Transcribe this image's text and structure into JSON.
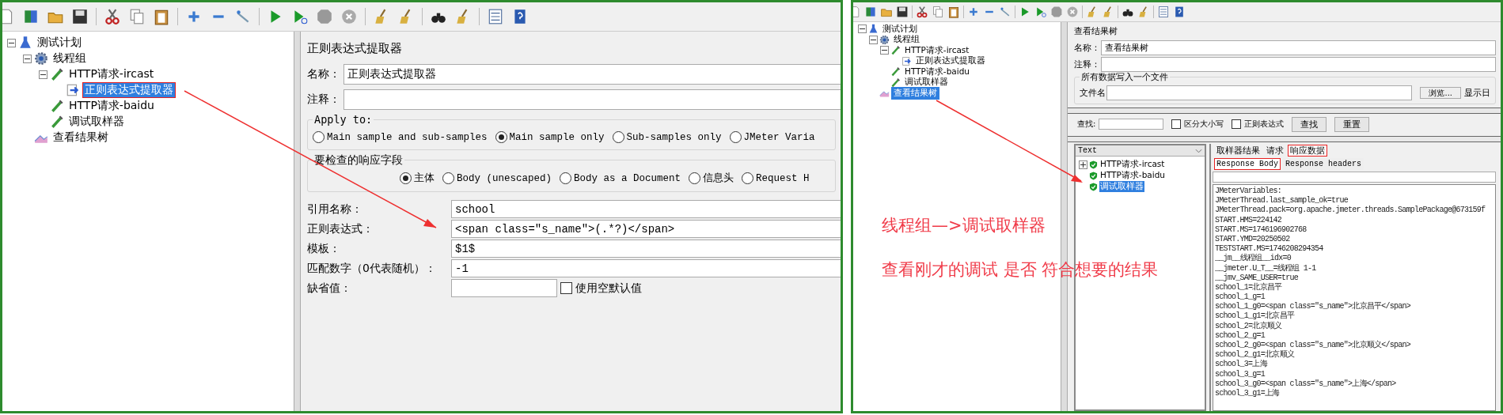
{
  "left_window": {
    "tree": [
      {
        "label": "测试计划",
        "kind": "plan",
        "selected": false,
        "expanded": true,
        "children": [
          {
            "label": "线程组",
            "kind": "threads",
            "selected": false,
            "expanded": true,
            "children": [
              {
                "label": "HTTP请求-ircast",
                "kind": "sampler",
                "selected": false,
                "expanded": true,
                "children": [
                  {
                    "label": "正则表达式提取器",
                    "kind": "extractor",
                    "selected": true,
                    "highlighted": true
                  }
                ]
              },
              {
                "label": "HTTP请求-baidu",
                "kind": "sampler",
                "selected": false
              },
              {
                "label": "调试取样器",
                "kind": "sampler",
                "selected": false
              }
            ]
          },
          {
            "label": "查看结果树",
            "kind": "listener",
            "selected": false
          }
        ]
      }
    ],
    "editor": {
      "title": "正则表达式提取器",
      "name_label": "名称：",
      "name_value": "正则表达式提取器",
      "comment_label": "注释：",
      "apply_to": {
        "legend": "Apply to:",
        "options": [
          {
            "label": "Main sample and sub-samples",
            "selected": false
          },
          {
            "label": "Main sample only",
            "selected": true
          },
          {
            "label": "Sub-samples only",
            "selected": false
          },
          {
            "label": "JMeter Varia",
            "selected": false
          }
        ]
      },
      "field_to_check": {
        "legend": "要检查的响应字段",
        "options": [
          {
            "label": "主体",
            "selected": true
          },
          {
            "label": "Body (unescaped)",
            "selected": false
          },
          {
            "label": "Body as a Document",
            "selected": false
          },
          {
            "label": "信息头",
            "selected": false
          },
          {
            "label": "Request H",
            "selected": false
          }
        ]
      },
      "fields": [
        {
          "label": "引用名称：",
          "value": "school"
        },
        {
          "label": "正则表达式：",
          "value": "<span class=\"s_name\">(.*?)</span>"
        },
        {
          "label": "模板：",
          "value": "$1$"
        },
        {
          "label": "匹配数字（0代表随机）：",
          "value": "-1"
        }
      ],
      "default": {
        "label": "缺省值：",
        "checkbox_label": "使用空默认值",
        "checked": false
      }
    }
  },
  "right_window": {
    "tree": [
      {
        "label": "测试计划",
        "kind": "plan",
        "selected": false,
        "expanded": true,
        "children": [
          {
            "label": "线程组",
            "kind": "threads",
            "selected": false,
            "expanded": true,
            "children": [
              {
                "label": "HTTP请求-ircast",
                "kind": "sampler",
                "selected": false,
                "expanded": true,
                "children": [
                  {
                    "label": "正则表达式提取器",
                    "kind": "extractor",
                    "selected": false
                  }
                ]
              },
              {
                "label": "HTTP请求-baidu",
                "kind": "sampler",
                "selected": false
              },
              {
                "label": "调试取样器",
                "kind": "sampler",
                "selected": false
              }
            ]
          },
          {
            "label": "查看结果树",
            "kind": "listener",
            "selected": true
          }
        ]
      }
    ],
    "editor": {
      "title": "查看结果树",
      "name_label": "名称：",
      "name_value": "查看结果树",
      "comment_label": "注释：",
      "file_group": {
        "legend": "所有数据写入一个文件",
        "file_label": "文件名",
        "browse_button": "浏览...",
        "log_label": "显示日"
      },
      "search": {
        "label": "查找:",
        "case_label": "区分大小写",
        "case_checked": false,
        "regex_label": "正则表达式",
        "regex_checked": false,
        "find_button": "查找",
        "reset_button": "重置"
      },
      "results": {
        "renderer": "Text",
        "items": [
          {
            "label": "HTTP请求-ircast",
            "selected": false,
            "expanded": false
          },
          {
            "label": "HTTP请求-baidu",
            "selected": false
          },
          {
            "label": "调试取样器",
            "selected": true
          }
        ],
        "tabs": [
          {
            "label": "取样器结果",
            "selected": false,
            "highlighted": false
          },
          {
            "label": "请求",
            "selected": false,
            "highlighted": false
          },
          {
            "label": "响应数据",
            "selected": true,
            "highlighted": true
          }
        ],
        "sub_tabs": [
          {
            "label": "Response Body",
            "selected": true,
            "highlighted": true
          },
          {
            "label": "Response headers",
            "selected": false,
            "highlighted": false
          }
        ],
        "body_lines": [
          "JMeterVariables:",
          "JMeterThread.last_sample_ok=true",
          "JMeterThread.pack=org.apache.jmeter.threads.SamplePackage@673159f",
          "START.HMS=224142",
          "START.MS=1746196902768",
          "START.YMD=20250502",
          "TESTSTART.MS=1746208294354",
          "__jm__线程组__idx=0",
          "__jmeter.U_T__=线程组 1-1",
          "__jmv_SAME_USER=true",
          "school_1=北京昌平",
          "school_1_g=1",
          "school_1_g0=<span class=\"s_name\">北京昌平</span>",
          "school_1_g1=北京昌平",
          "school_2=北京顺义",
          "school_2_g=1",
          "school_2_g0=<span class=\"s_name\">北京顺义</span>",
          "school_2_g1=北京顺义",
          "school_3=上海",
          "school_3_g=1",
          "school_3_g0=<span class=\"s_name\">上海</span>",
          "school_3_g1=上海"
        ]
      }
    },
    "notes": [
      "线程组—>调试取样器",
      "查看刚才的调试 是否 符合想要的结果"
    ]
  }
}
